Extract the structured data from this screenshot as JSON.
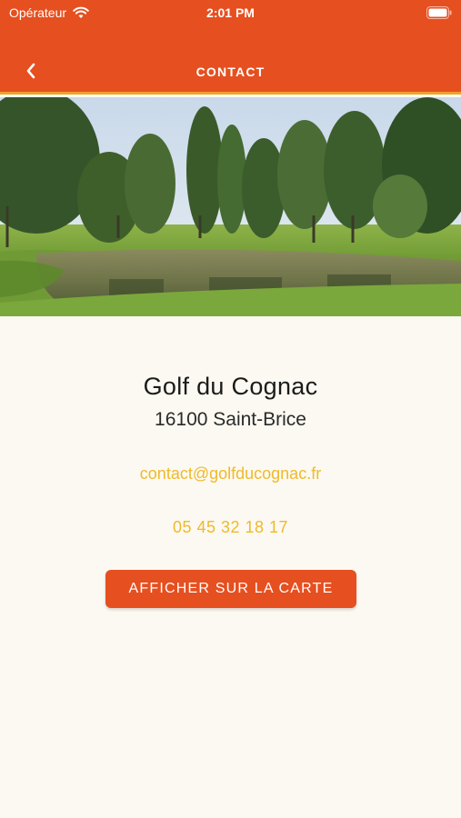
{
  "status_bar": {
    "carrier": "Opérateur",
    "time": "2:01 PM",
    "wifi_icon": "wifi-icon",
    "battery_icon": "battery-icon"
  },
  "nav": {
    "title": "CONTACT",
    "back_icon": "chevron-left-icon"
  },
  "hero": {
    "image": "golf-course-pond-photo"
  },
  "contact": {
    "name": "Golf du Cognac",
    "address": "16100 Saint-Brice",
    "email": "contact@golfducognac.fr",
    "phone": "05 45 32 18 17",
    "map_button_label": "AFFICHER SUR LA CARTE"
  },
  "colors": {
    "primary": "#e64f1f",
    "accent": "#f0b92b",
    "header_border": "#f0a22a",
    "background": "#fbf9f1"
  }
}
